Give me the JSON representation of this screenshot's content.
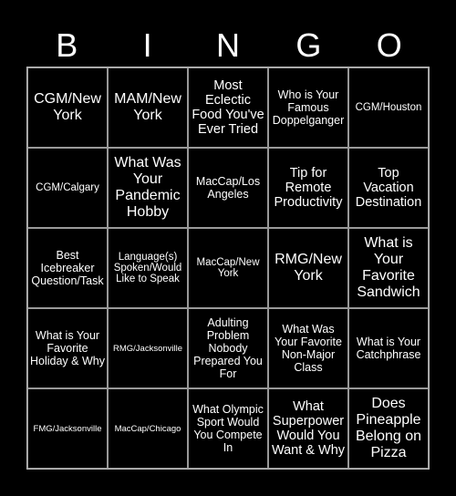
{
  "header": [
    "B",
    "I",
    "N",
    "G",
    "O"
  ],
  "cells": [
    [
      "CGM/New York",
      "MAM/New York",
      "Most Eclectic Food You've Ever Tried",
      "Who is Your Famous Doppelganger",
      "CGM/Houston"
    ],
    [
      "CGM/Calgary",
      "What Was Your Pandemic Hobby",
      "MacCap/Los Angeles",
      "Tip for Remote Productivity",
      "Top Vacation Destination"
    ],
    [
      "Best Icebreaker Question/Task",
      "Language(s) Spoken/Would Like to Speak",
      "MacCap/New York",
      "RMG/New York",
      "What is Your Favorite Sandwich"
    ],
    [
      "What is Your Favorite Holiday & Why",
      "RMG/Jacksonville",
      "Adulting Problem Nobody Prepared You For",
      "What Was Your Favorite Non-Major Class",
      "What is Your Catchphrase"
    ],
    [
      "FMG/Jacksonville",
      "MacCap/Chicago",
      "What Olympic Sport Would You Compete In",
      "What Superpower Would You Want & Why",
      "Does Pineapple Belong on Pizza"
    ]
  ]
}
